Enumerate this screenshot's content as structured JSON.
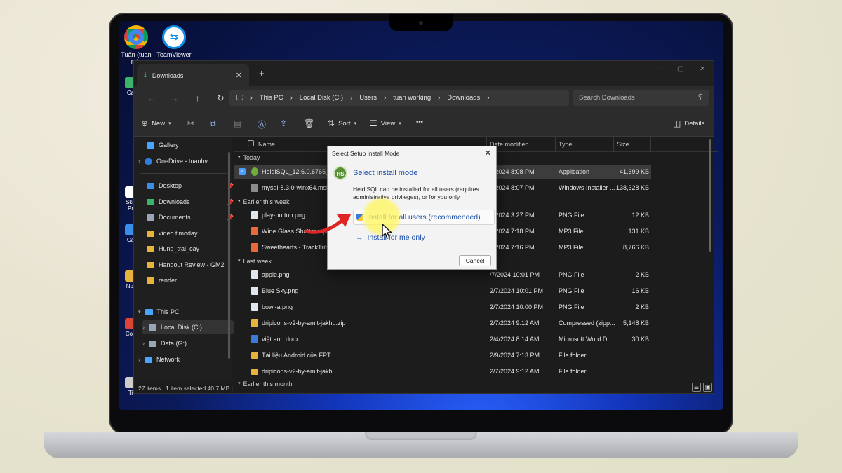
{
  "desktop": {
    "icons": [
      {
        "label": "Tuấn (tuan min"
      },
      {
        "label": "TeamViewer"
      }
    ],
    "left_labels": [
      "Ca",
      "Ske Pr",
      "Cả",
      "Not",
      "Coc",
      "Ti"
    ]
  },
  "window": {
    "tab_title": "Downloads",
    "new_tab": "+",
    "controls": {
      "minimize": "—",
      "maximize": "▢",
      "close": "✕"
    }
  },
  "nav": {
    "back": "←",
    "forward": "→",
    "up": "↑",
    "refresh": "↻",
    "breadcrumb": [
      "This PC",
      "Local Disk (C:)",
      "Users",
      "tuan working",
      "Downloads"
    ],
    "search_placeholder": "Search Downloads"
  },
  "toolbar": {
    "new_label": "New",
    "sort_label": "Sort",
    "view_label": "View",
    "more_label": "•••",
    "details_label": "Details"
  },
  "sidebar": {
    "items": [
      {
        "label": "Gallery",
        "color": "#4aa3ff"
      },
      {
        "label": "OneDrive - tuanhv",
        "color": "#2f7de0"
      },
      {
        "label": "Desktop",
        "color": "#3b8ee8",
        "pinned": true
      },
      {
        "label": "Downloads",
        "color": "#3bb36a",
        "pinned": true
      },
      {
        "label": "Documents",
        "color": "#9aa6b8",
        "pinned": true
      },
      {
        "label": "video timoday",
        "color": "#e8b33a"
      },
      {
        "label": "Hung_trai_cay",
        "color": "#e8b33a"
      },
      {
        "label": "Handout Review - GM2",
        "color": "#e8b33a"
      },
      {
        "label": "render",
        "color": "#e8b33a"
      },
      {
        "label": "This PC",
        "color": "#4aa3ff"
      },
      {
        "label": "Local Disk (C:)",
        "color": "#9aa6b8"
      },
      {
        "label": "Data (G:)",
        "color": "#9aa6b8"
      },
      {
        "label": "Network",
        "color": "#4aa3ff"
      }
    ],
    "pin_glyph": "📌"
  },
  "columns": {
    "name": "Name",
    "date": "Date modified",
    "type": "Type",
    "size": "Size"
  },
  "groups": {
    "today": "Today",
    "earlier_week": "Earlier this week",
    "last_week": "Last week",
    "earlier_month": "Earlier this month"
  },
  "files": [
    {
      "name": "HeidiSQL_12.6.0.6765_Setu",
      "date": "6/2024 8:08 PM",
      "type": "Application",
      "size": "41,699 KB",
      "color": "#6fae3c"
    },
    {
      "name": "mysql-8.3.0-winx64.msi",
      "date": "6/2024 8:07 PM",
      "type": "Windows Installer ...",
      "size": "138,328 KB",
      "color": "#8d8d8d"
    },
    {
      "name": "play-button.png",
      "date": "2/2024 3:27 PM",
      "type": "PNG File",
      "size": "12 KB",
      "color": "#dfe6ee"
    },
    {
      "name": "Wine Glass Shatter.mp3",
      "date": "1/2024 7:18 PM",
      "type": "MP3 File",
      "size": "131 KB",
      "color": "#e86a3a"
    },
    {
      "name": "Sweethearts - TrackTribe.m",
      "date": "1/2024 7:16 PM",
      "type": "MP3 File",
      "size": "8,766 KB",
      "color": "#e86a3a"
    },
    {
      "name": "apple.png",
      "date": "/7/2024 10:01 PM",
      "type": "PNG File",
      "size": "2 KB",
      "color": "#dfe6ee"
    },
    {
      "name": "Blue Sky.png",
      "date": "2/7/2024 10:01 PM",
      "type": "PNG File",
      "size": "16 KB",
      "color": "#dfe6ee"
    },
    {
      "name": "bowl-a.png",
      "date": "2/7/2024 10:00 PM",
      "type": "PNG File",
      "size": "2 KB",
      "color": "#dfe6ee"
    },
    {
      "name": "dripicons-v2-by-amit-jakhu.zip",
      "date": "2/7/2024 9:12 AM",
      "type": "Compressed (zipp...",
      "size": "5,148 KB",
      "color": "#e8b33a"
    },
    {
      "name": "việt anh.docx",
      "date": "2/4/2024 8:14 AM",
      "type": "Microsoft Word D...",
      "size": "30 KB",
      "color": "#3b7ad9"
    },
    {
      "name": "Tài liệu Android của FPT",
      "date": "2/9/2024 7:13 PM",
      "type": "File folder",
      "size": "",
      "color": "#e8b33a"
    },
    {
      "name": "dripicons-v2-by-amit-jakhu",
      "date": "2/7/2024 9:12 AM",
      "type": "File folder",
      "size": "",
      "color": "#e8b33a"
    }
  ],
  "status": {
    "text": "27 items  |  1 item selected  40.7 MB  |"
  },
  "dialog": {
    "title": "Select Setup Install Mode",
    "close": "✕",
    "logo": "HS",
    "heading": "Select install mode",
    "description": "HeidiSQL can be installed for all users (requires administrative privileges), or for you only.",
    "option_all": "Install for all users (recommended)",
    "option_me": "Install for me only",
    "option_me_arrow": "→",
    "cancel": "Cancel"
  },
  "colors": {
    "accent": "#1a4ea8",
    "highlight": "#fff55a",
    "arrow": "#e02424"
  }
}
